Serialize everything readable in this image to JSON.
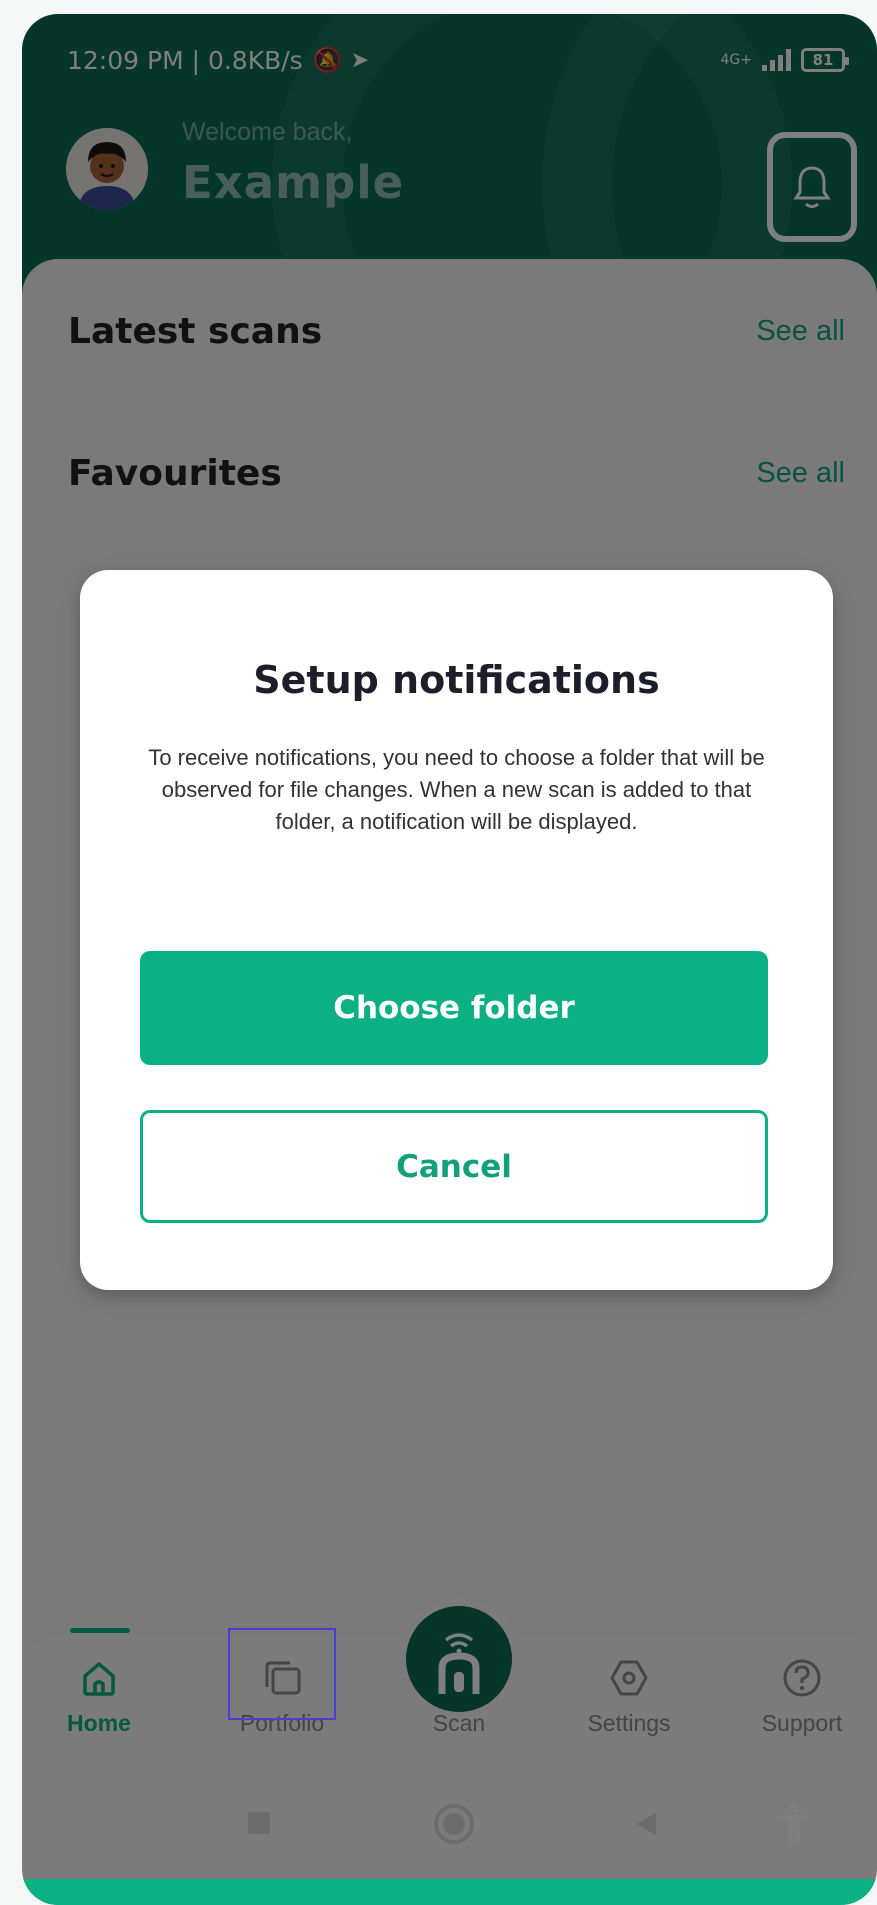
{
  "status_bar": {
    "time": "12:09 PM | 0.8KB/s",
    "network": "4G+",
    "battery": "81"
  },
  "header": {
    "welcome": "Welcome back,",
    "username": "Example"
  },
  "sections": {
    "latest_scans": "Latest scans",
    "favourites": "Favourites",
    "see_all": "See all"
  },
  "dialog": {
    "title": "Setup notifications",
    "body": "To receive notifications, you need to choose a folder that will be observed for file changes. When a new scan is added to that folder, a notification will be displayed.",
    "primary_button": "Choose folder",
    "secondary_button": "Cancel"
  },
  "bottom_nav": {
    "items": [
      {
        "label": "Home",
        "icon": "home-icon",
        "active": true
      },
      {
        "label": "Portfolio",
        "icon": "folders-icon",
        "active": false
      },
      {
        "label": "Scan",
        "icon": "scan-icon",
        "active": false
      },
      {
        "label": "Settings",
        "icon": "hexagon-settings-icon",
        "active": false
      },
      {
        "label": "Support",
        "icon": "question-circle-icon",
        "active": false
      }
    ]
  },
  "colors": {
    "brand_dark": "#0c6b53",
    "brand_accent": "#0bb184"
  }
}
